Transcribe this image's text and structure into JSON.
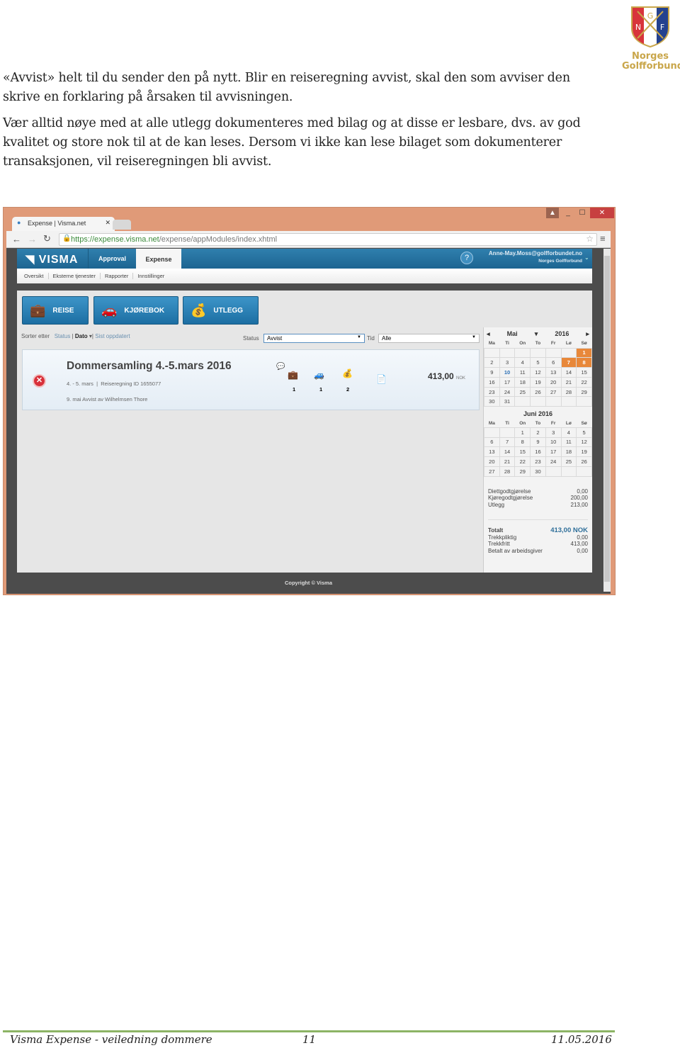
{
  "document": {
    "paragraphs": [
      "«Avvist» helt til du sender den på nytt. Blir en reiseregning avvist, skal den som avviser den skrive en forklaring på årsaken til avvisningen.",
      "Vær alltid nøye med at alle utlegg dokumenteres med bilag og at disse er lesbare, dvs. av god kvalitet og store nok til at de kan leses. Dersom vi ikke kan lese bilaget som dokumenterer transaksjonen, vil reiseregningen bli avvist."
    ],
    "logo": {
      "letters": "NGF",
      "line1": "Norges",
      "line2": "Golfforbund"
    },
    "footer": {
      "left": "Visma Expense - veiledning dommere",
      "page": "11",
      "date": "11.05.2016"
    }
  },
  "browser": {
    "tab_title": "Expense | Visma.net",
    "url_host": "https://expense.visma.net",
    "url_path": "/expense/appModules/index.xhtml"
  },
  "app": {
    "brand": "VISMA",
    "nav": [
      "Approval",
      "Expense"
    ],
    "user_email": "Anne-May.Moss@golfforbundet.no",
    "user_org": "Norges Golfforbund",
    "subnav": [
      "Oversikt",
      "Eksterne tjenester",
      "Rapporter",
      "Innstillinger"
    ],
    "buttons": [
      "REISE",
      "KJØREBOK",
      "UTLEGG"
    ],
    "sort": {
      "label": "Sorter etter",
      "options": [
        "Status",
        "Dato",
        "Sist oppdatert"
      ]
    },
    "filters": {
      "status_label": "Status",
      "status_value": "Avvist",
      "time_label": "Tid",
      "time_value": "Alle"
    },
    "report": {
      "title": "Dommersamling 4.-5.mars 2016",
      "dates": "4. - 5. mars",
      "id": "Reiseregning ID 1655077",
      "status_line": "9. mai Avvist av Wilhelmsen Thore",
      "counts": [
        "1",
        "1",
        "2"
      ],
      "amount": "413,00",
      "currency": "NOK"
    },
    "calendar": {
      "dow": [
        "Ma",
        "Ti",
        "On",
        "To",
        "Fr",
        "Lø",
        "Sø"
      ],
      "may": {
        "month": "Mai",
        "year": "2016",
        "weeks": [
          [
            "",
            "",
            "",
            "",
            "",
            "",
            "1"
          ],
          [
            "2",
            "3",
            "4",
            "5",
            "6",
            "7",
            "8"
          ],
          [
            "9",
            "10",
            "11",
            "12",
            "13",
            "14",
            "15"
          ],
          [
            "16",
            "17",
            "18",
            "19",
            "20",
            "21",
            "22"
          ],
          [
            "23",
            "24",
            "25",
            "26",
            "27",
            "28",
            "29"
          ],
          [
            "30",
            "31",
            "",
            "",
            "",
            "",
            ""
          ]
        ],
        "highlighted": [
          "1",
          "7",
          "8"
        ],
        "today": "10"
      },
      "june": {
        "title": "Juni 2016",
        "weeks": [
          [
            "",
            "",
            "1",
            "2",
            "3",
            "4",
            "5"
          ],
          [
            "6",
            "7",
            "8",
            "9",
            "10",
            "11",
            "12"
          ],
          [
            "13",
            "14",
            "15",
            "16",
            "17",
            "18",
            "19"
          ],
          [
            "20",
            "21",
            "22",
            "23",
            "24",
            "25",
            "26"
          ],
          [
            "27",
            "28",
            "29",
            "30",
            "",
            "",
            ""
          ]
        ]
      }
    },
    "summary": [
      {
        "label": "Diettgodtgjørelse",
        "value": "0,00"
      },
      {
        "label": "Kjøregodtgjørelse",
        "value": "200,00"
      },
      {
        "label": "Utlegg",
        "value": "213,00"
      }
    ],
    "totals": {
      "label": "Totalt",
      "value": "413,00 NOK",
      "rows": [
        {
          "label": "Trekkpliktig",
          "value": "0,00"
        },
        {
          "label": "Trekkfritt",
          "value": "413,00"
        },
        {
          "label": "Betalt av arbeidsgiver",
          "value": "0,00"
        }
      ]
    },
    "copyright": "Copyright © Visma"
  }
}
